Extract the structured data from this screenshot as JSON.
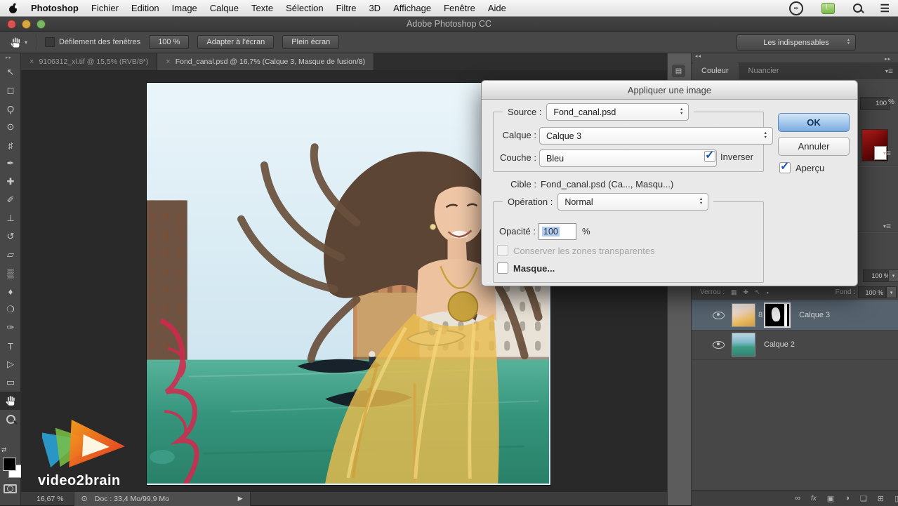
{
  "window": {
    "title": "Adobe Photoshop CC"
  },
  "menubar": {
    "app_name": "Photoshop",
    "items": [
      "Fichier",
      "Edition",
      "Image",
      "Calque",
      "Texte",
      "Sélection",
      "Filtre",
      "3D",
      "Affichage",
      "Fenêtre",
      "Aide"
    ],
    "right_icons": [
      "creative-cloud",
      "download",
      "search",
      "menu-list"
    ]
  },
  "options_bar": {
    "active_tool": "hand",
    "scroll_all_windows_label": "Défilement des fenêtres",
    "zoom_100_label": "100 %",
    "fit_screen_label": "Adapter à l'écran",
    "fill_screen_label": "Plein écran",
    "workspace_value": "Les indispensables"
  },
  "document_tabs": [
    {
      "label": "9106312_xl.tif @ 15,5% (RVB/8*)",
      "active": false
    },
    {
      "label": "Fond_canal.psd @ 16,7% (Calque 3, Masque de fusion/8)",
      "active": true
    }
  ],
  "tools": [
    {
      "name": "move",
      "glyph": "↖"
    },
    {
      "name": "marquee",
      "glyph": "◻"
    },
    {
      "name": "lasso",
      "glyph": "Ϙ"
    },
    {
      "name": "quick-selection",
      "glyph": "⊙"
    },
    {
      "name": "crop",
      "glyph": "♯"
    },
    {
      "name": "eyedropper",
      "glyph": "✒"
    },
    {
      "name": "healing-brush",
      "glyph": "✚"
    },
    {
      "name": "brush",
      "glyph": "✐"
    },
    {
      "name": "clone-stamp",
      "glyph": "⊥"
    },
    {
      "name": "history-brush",
      "glyph": "↺"
    },
    {
      "name": "eraser",
      "glyph": "▱"
    },
    {
      "name": "gradient",
      "glyph": "▒"
    },
    {
      "name": "blur",
      "glyph": "♦"
    },
    {
      "name": "dodge",
      "glyph": "❍"
    },
    {
      "name": "pen",
      "glyph": "✑"
    },
    {
      "name": "type",
      "glyph": "T"
    },
    {
      "name": "path-selection",
      "glyph": "▷"
    },
    {
      "name": "rectangle",
      "glyph": "▭"
    },
    {
      "name": "hand",
      "glyph": "✋",
      "selected": true
    },
    {
      "name": "zoom",
      "glyph": "⌕"
    }
  ],
  "dialog": {
    "title": "Appliquer une image",
    "source_label": "Source :",
    "source_value": "Fond_canal.psd",
    "layer_label": "Calque :",
    "layer_value": "Calque 3",
    "channel_label": "Couche :",
    "channel_value": "Bleu",
    "invert_label": "Inverser",
    "ok_label": "OK",
    "cancel_label": "Annuler",
    "preview_label": "Aperçu",
    "target_label": "Cible :",
    "target_value": "Fond_canal.psd (Ca..., Masqu...)",
    "operation_label": "Opération :",
    "operation_value": "Normal",
    "opacity_label": "Opacité :",
    "opacity_value": "100",
    "opacity_unit": "%",
    "preserve_label": "Conserver les zones transparentes",
    "mask_label": "Masque..."
  },
  "right_panels": {
    "color_tab_label": "Couleur",
    "swatches_tab_label": "Nuancier",
    "value_field": "100",
    "percent_sign": "%"
  },
  "layers_panel": {
    "opacity_fragment": "100 %",
    "lock_label": "Verrou :",
    "fill_label": "Fond :",
    "fill_value": "100 %",
    "layers": [
      {
        "name": "Calque 3",
        "selected": true,
        "has_mask": true
      },
      {
        "name": "Calque 2",
        "selected": false,
        "has_mask": false
      }
    ]
  },
  "status_bar": {
    "zoom_level": "16,67 %",
    "doc_info": "Doc : 33,4 Mo/99,9 Mo"
  },
  "branding": {
    "logo_text": "video2brain"
  },
  "glyphs": {
    "tab_close": "×",
    "menu_list": "☰",
    "panel_menu": "▾☰",
    "dropdown_caret": "▾",
    "play": "▶",
    "collapse_arrows": "◂◂",
    "expand_arrows": "▸▸",
    "mask_link": "8",
    "dock_icon": "▤",
    "status_icon": "⊙",
    "swap_icon": "⇄",
    "hand_caret": "▾",
    "lock_icons": [
      "▦",
      "✚",
      "↖",
      "▪"
    ],
    "layerbar_link": "∞",
    "layerbar_fx": "fx",
    "layerbar_mask": "▣",
    "layerbar_adjust": "◑",
    "layerbar_group": "❏",
    "layerbar_new": "⊞",
    "layerbar_trash": "▯"
  },
  "colors": {
    "ok_button_blue": "#79abe0",
    "selected_layer_row": "#56636f",
    "canvas_water_teal": "#3a9c82",
    "dress_gold": "#e9bc4e",
    "logo_orange": "#f7941e",
    "logo_green": "#7ac143",
    "logo_blue": "#2aa9e0"
  }
}
